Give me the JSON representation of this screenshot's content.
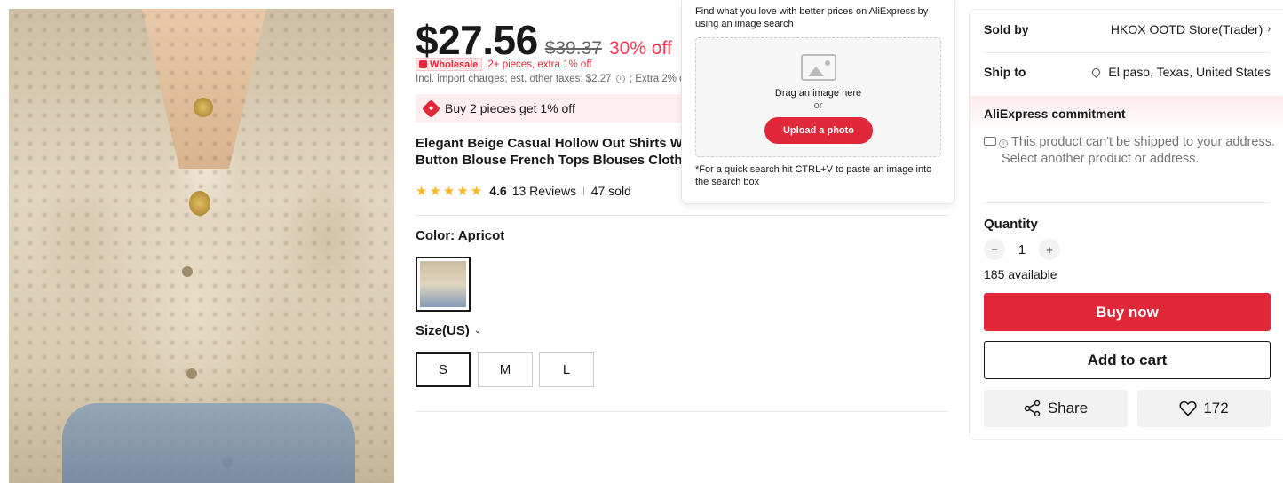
{
  "product": {
    "image_alt": "Woman wearing a beige crochet hollow-out cardigan"
  },
  "price": {
    "current": "$27.56",
    "original": "$39.37",
    "discount": "30% off"
  },
  "wholesale": {
    "badge": "Wholesale",
    "text": "2+ pieces, extra 1% off"
  },
  "import_charges": {
    "text": "Incl. import charges; est. other taxes: $2.27",
    "extra": "; Extra 2% off"
  },
  "promo": {
    "text": "Buy 2 pieces get 1% off"
  },
  "title": {
    "line1": "Elegant Beige Casual Hollow Out Shirts Wom",
    "line2": "Button Blouse French Tops Blouses Clothes"
  },
  "rating": {
    "score": "4.6",
    "reviews": "13 Reviews",
    "sold": "47 sold",
    "stars": "★★★★★"
  },
  "color": {
    "label": "Color: Apricot"
  },
  "size": {
    "label": "Size(US)",
    "options": [
      "S",
      "M",
      "L"
    ]
  },
  "image_search": {
    "hint": "Find what you love with better prices on AliExpress by using an image search",
    "drag": "Drag an image here",
    "or": "or",
    "upload": "Upload a photo",
    "paste": "*For a quick search hit CTRL+V to paste an image into the search box"
  },
  "seller": {
    "sold_by_label": "Sold by",
    "store": "HKOX OOTD Store(Trader)",
    "ship_to_label": "Ship to",
    "ship_to": "El paso, Texas, United States"
  },
  "commitment": {
    "label": "AliExpress commitment"
  },
  "shipping_warning": {
    "line1": "This product can't be shipped to your address.",
    "line2": "Select another product or address."
  },
  "quantity": {
    "label": "Quantity",
    "value": "1",
    "available": "185 available"
  },
  "actions": {
    "buy_now": "Buy now",
    "add_to_cart": "Add to cart",
    "share": "Share",
    "wishlist_count": "172"
  },
  "colors": {
    "accent_red": "#e02838",
    "discount_red": "#fd384f",
    "star_gold": "#fdb627"
  }
}
